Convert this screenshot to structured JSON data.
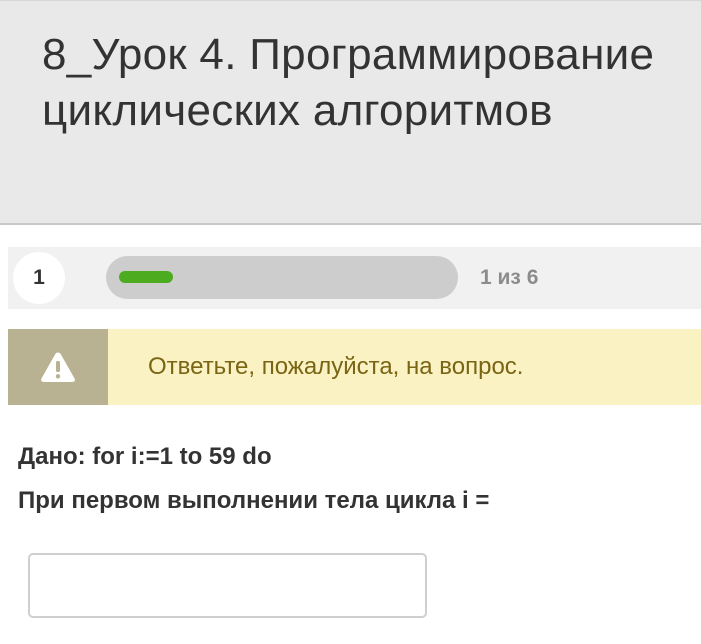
{
  "header": {
    "title": "8_Урок 4. Программирование циклических алгоритмов"
  },
  "progress": {
    "question_number": "1",
    "counter": "1 из 6",
    "fill_fraction": 0.167,
    "fill_color": "#4cab1e",
    "track_color": "#cdcdcd"
  },
  "alert": {
    "icon": "warning-icon",
    "message": "Ответьте, пожалуйста, на вопрос.",
    "background_color": "#fbf2c4",
    "icon_box_color": "#b8b192",
    "text_color": "#7a6514"
  },
  "question": {
    "line1": "Дано: for i:=1 to 59 do",
    "line2": "При первом выполнении тела цикла i ="
  },
  "answer": {
    "value": "",
    "placeholder": ""
  }
}
